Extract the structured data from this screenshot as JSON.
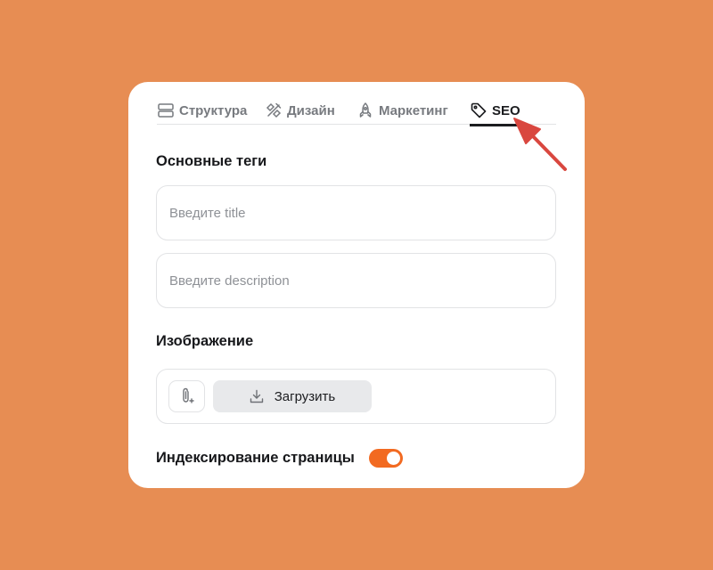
{
  "tabs": [
    {
      "id": "structure",
      "label": "Структура",
      "icon": "layout-rows-icon",
      "active": false
    },
    {
      "id": "design",
      "label": "Дизайн",
      "icon": "design-tools-icon",
      "active": false
    },
    {
      "id": "marketing",
      "label": "Маркетинг",
      "icon": "rocket-icon",
      "active": false
    },
    {
      "id": "seo",
      "label": "SEO",
      "icon": "tag-icon",
      "active": true
    }
  ],
  "basic_tags": {
    "title": "Основные теги",
    "title_field": {
      "value": "",
      "placeholder": "Введите title"
    },
    "description_field": {
      "value": "",
      "placeholder": "Введите description"
    }
  },
  "image": {
    "title": "Изображение",
    "attach_icon": "paperclip-plus-icon",
    "upload_label": "Загрузить",
    "upload_icon": "download-icon"
  },
  "indexing": {
    "label": "Индексирование страницы",
    "enabled": true
  },
  "colors": {
    "background": "#E78D53",
    "accent": "#F26A21",
    "annotation_arrow": "#D9473F",
    "text_primary": "#17181B",
    "text_muted": "#777A7F"
  }
}
